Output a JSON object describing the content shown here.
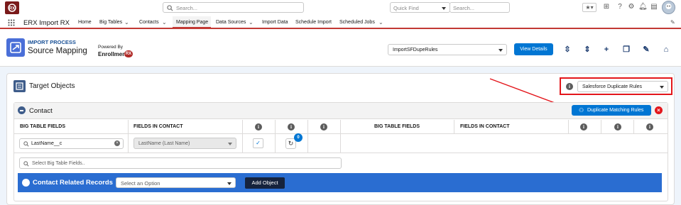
{
  "global": {
    "search_placeholder": "Search...",
    "quick_find_placeholder": "Quick Find",
    "search_right_placeholder": "Search..."
  },
  "nav": {
    "app_name": "ERX Import RX",
    "items": [
      {
        "label": "Home",
        "has_menu": false
      },
      {
        "label": "Big Tables",
        "has_menu": true
      },
      {
        "label": "Contacts",
        "has_menu": true
      },
      {
        "label": "Mapping Page",
        "has_menu": false,
        "active": true
      },
      {
        "label": "Data Sources",
        "has_menu": true
      },
      {
        "label": "Import Data",
        "has_menu": false
      },
      {
        "label": "Schedule Import",
        "has_menu": false
      },
      {
        "label": "Scheduled Jobs",
        "has_menu": true
      }
    ]
  },
  "header": {
    "eyebrow": "IMPORT PROCESS",
    "title": "Source Mapping",
    "powered_by": "Powered By",
    "brand": "Enrollment",
    "brand_badge": "RX",
    "rule_select_value": "ImportSFDupeRules",
    "view_details_label": "View Details"
  },
  "target_objects": {
    "title": "Target Objects",
    "dup_rule_select_value": "Salesforce Duplicate Rules"
  },
  "contact": {
    "title": "Contact",
    "dup_matching_label": "Duplicate Matching Rules",
    "columns_left": [
      "BIG TABLE FIELDS",
      "FIELDS IN CONTACT"
    ],
    "columns_right": [
      "BIG TABLE FIELDS",
      "FIELDS IN CONTACT"
    ],
    "row": {
      "big_table_field": "LastName__c",
      "contact_field": "LastName (Last Name)",
      "badge_count": "0"
    },
    "big_table_search_placeholder": "Select Big Table Fields..",
    "related_title": "Contact Related Records",
    "related_select_value": "Select an Option",
    "add_object_label": "Add Object"
  },
  "colors": {
    "brand_blue": "#0176d3",
    "related_bar": "#2a6dd1",
    "accent_red": "#e3161b",
    "nav_active": "#c23934"
  }
}
